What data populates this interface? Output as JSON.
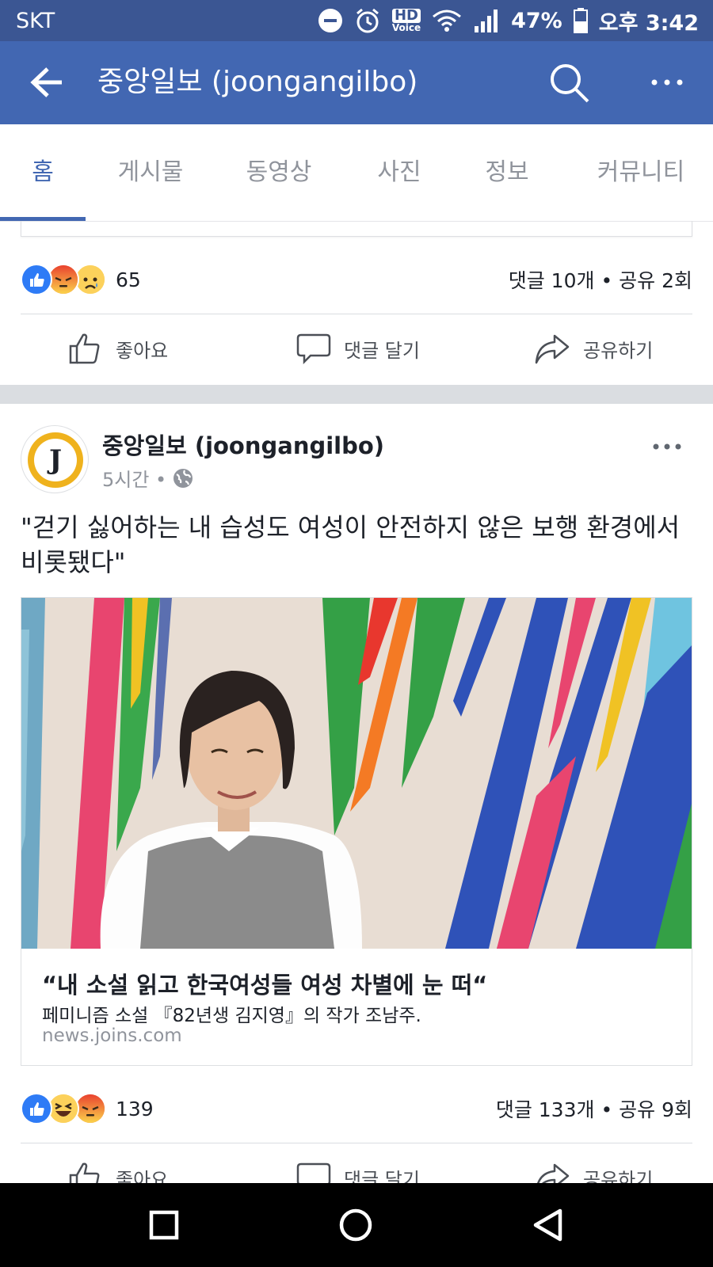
{
  "status_bar": {
    "carrier": "SKT",
    "battery": "47%",
    "time": "오후 3:42",
    "hd_label": "HD",
    "voice_label": "Voice"
  },
  "app_bar": {
    "title": "중앙일보 (joongangilbo)",
    "icons": [
      "back-arrow-icon",
      "search-icon",
      "more-icon"
    ]
  },
  "tabs": [
    {
      "label": "홈",
      "active": true
    },
    {
      "label": "게시물",
      "active": false
    },
    {
      "label": "동영상",
      "active": false
    },
    {
      "label": "사진",
      "active": false
    },
    {
      "label": "정보",
      "active": false
    },
    {
      "label": "커뮤니티",
      "active": false
    }
  ],
  "post1": {
    "reaction_count": "65",
    "reactions": [
      "like",
      "angry",
      "sad"
    ],
    "comments_shares": "댓글 10개 • 공유 2회"
  },
  "actions": {
    "like": "좋아요",
    "comment": "댓글 달기",
    "share": "공유하기"
  },
  "post2": {
    "page_name": "중앙일보 (joongangilbo)",
    "avatar_letter": "J",
    "time": "5시간 •",
    "text": "\"걷기 싫어하는 내 습성도 여성이 안전하지 않은 보행 환경에서 비롯됐다\"",
    "link": {
      "title": "“내 소설 읽고 한국여성들 여성 차별에 눈 떠“",
      "description": "페미니즘 소설 『82년생 김지영』의 작가 조남주.",
      "domain": "news.joins.com"
    },
    "reaction_count": "139",
    "reactions": [
      "like",
      "haha",
      "angry"
    ],
    "comments_shares": "댓글 133개 • 공유 9회"
  },
  "colors": {
    "facebook_blue": "#4267b2",
    "status_blue": "#3b5693",
    "gray_text": "#90949c",
    "avatar_ring": "#efb21d"
  }
}
